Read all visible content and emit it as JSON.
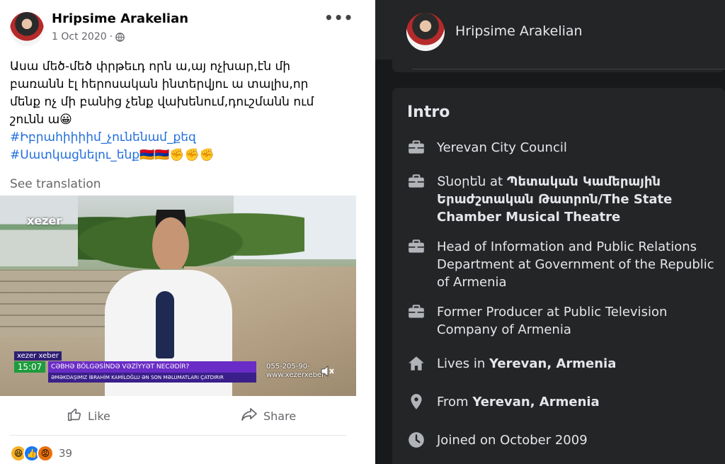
{
  "post": {
    "author": "Hripsime Arakelian",
    "date": "1 Oct 2020",
    "privacy_icon": "globe-icon",
    "more_icon": "more-options-icon",
    "body_lines": [
      "Ասա մեծ-մեծ փրթեւդ որն ա,այ ոչխար,էն մի",
      "բառանն էլ հերոսական  ինտերվյու ա տալիս,որ",
      "մենք ոչ մի բանից չենք վախենում,դուշմանն ում",
      "շունն ա😀"
    ],
    "hashtags": [
      "#Իբրահիիիիմ_չունենամ_քեզ",
      "#Սատկացնելու_ենք🇦🇲🇦🇲✊✊✊"
    ],
    "see_translation": "See translation",
    "video": {
      "channel_logo": "xezer",
      "brand": "xezer xeber",
      "time": "15:07",
      "headline": "CƏBHƏ BÖLGƏSİNDƏ VƏZİYYƏT NECƏDİR?",
      "subline": "ƏMƏKDAŞIMIZ İBRAHİM KAMİLOĞLU ƏN SON MƏLUMATLARI ÇATDIRIR",
      "phone": "055-205-90-",
      "site": "www.xezerxeber"
    },
    "actions": {
      "like": "Like",
      "share": "Share"
    },
    "reactions_count": "39"
  },
  "profile": {
    "name": "Hripsime Arakelian",
    "intro_title": "Intro",
    "items": [
      {
        "icon": "briefcase-icon",
        "text": "Yerevan City Council",
        "bold": ""
      },
      {
        "icon": "briefcase-icon",
        "text": "Տնօրեն at ",
        "bold": "Պետական Կամերային Երաժշտական Թատրոն/The State Chamber Musical Theatre"
      },
      {
        "icon": "briefcase-icon",
        "text": "Head of Information and Public Relations Department at Government of the Republic of Armenia",
        "bold": ""
      },
      {
        "icon": "briefcase-icon",
        "text": "Former Producer at Public Television Company of Armenia",
        "bold": ""
      },
      {
        "icon": "home-icon",
        "text": "Lives in ",
        "bold": "Yerevan, Armenia"
      },
      {
        "icon": "location-pin-icon",
        "text": "From ",
        "bold": "Yerevan, Armenia"
      },
      {
        "icon": "clock-icon",
        "text": "Joined on October 2009",
        "bold": ""
      }
    ]
  },
  "colors": {
    "hashtag": "#216fdb",
    "dark_bg": "#18191a",
    "dark_card": "#242526",
    "dark_text": "#e4e6eb"
  }
}
